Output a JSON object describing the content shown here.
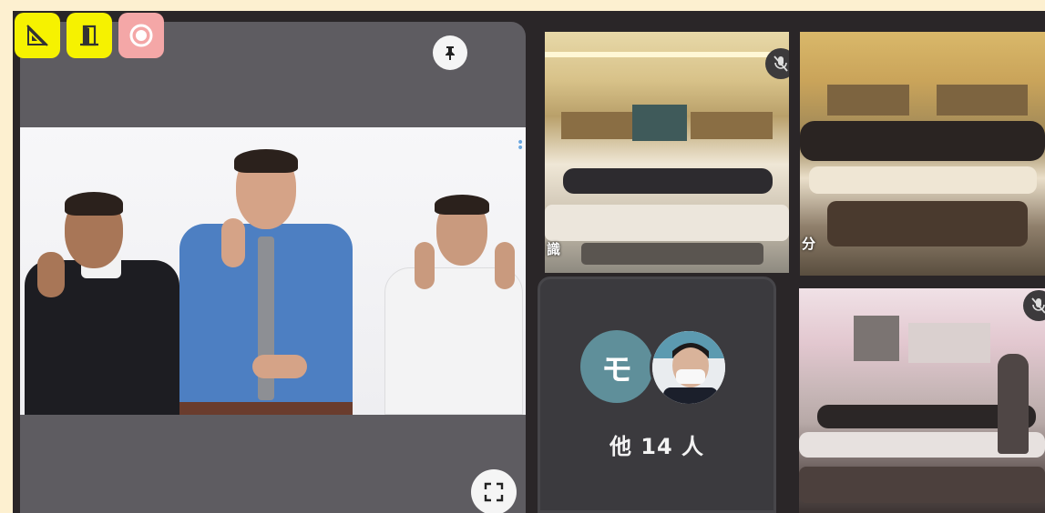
{
  "toolbar": {
    "buttons": [
      {
        "icon": "hide-layout-icon",
        "color": "#f6f200"
      },
      {
        "icon": "exit-door-icon",
        "color": "#f6f200"
      },
      {
        "icon": "record-icon",
        "color": "#f4a7a7"
      }
    ]
  },
  "main_tile": {
    "pin_glyph": "📌",
    "fullscreen_icon": "fullscreen-icon"
  },
  "tiles": {
    "classroom_1_caption": "識",
    "classroom_2_caption": "分"
  },
  "others": {
    "avatar_initial": "モ",
    "label": "他 14 人"
  },
  "colors": {
    "stage_bg": "#2a2628",
    "page_bg": "#fdf0d0",
    "accent_yellow": "#f6f200",
    "record_pink": "#f4a7a7",
    "avatar_teal": "#5f8f9a"
  }
}
